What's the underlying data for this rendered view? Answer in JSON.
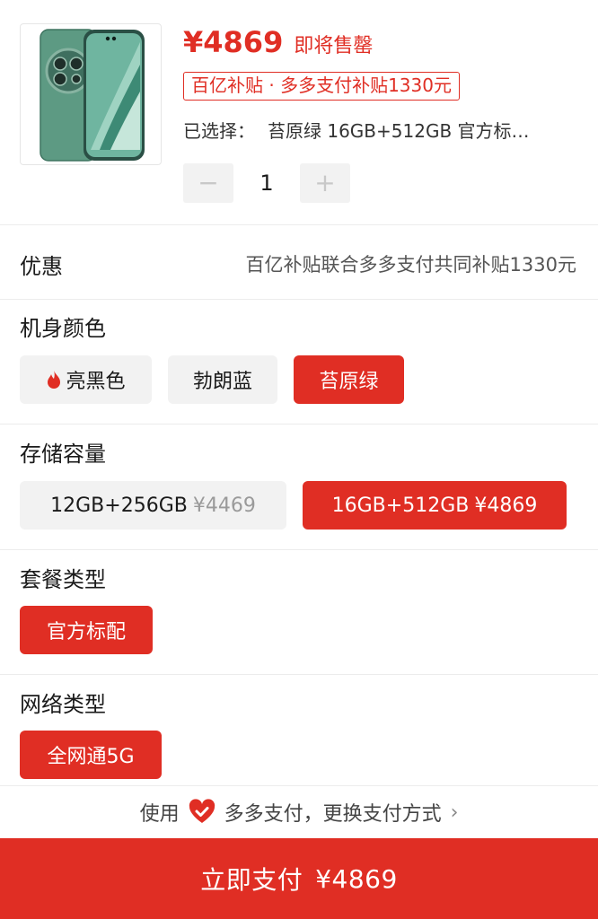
{
  "product": {
    "price": "¥4869",
    "status": "即将售罄",
    "subsidy_tag": "百亿补贴 · 多多支付补贴1330元",
    "selected_label": "已选择：",
    "selected_value": "苔原绿 16GB+512GB 官方标…",
    "quantity": "1",
    "minus": "−",
    "plus": "+",
    "image_icon": "phone-product-image"
  },
  "discount": {
    "title": "优惠",
    "value": "百亿补贴联合多多支付共同补贴1330元"
  },
  "color_section": {
    "title": "机身颜色",
    "options": [
      {
        "label": "亮黑色",
        "icon": "flame-icon",
        "selected": false
      },
      {
        "label": "勃朗蓝",
        "selected": false
      },
      {
        "label": "苔原绿",
        "selected": true
      }
    ]
  },
  "storage_section": {
    "title": "存储容量",
    "options": [
      {
        "label": "12GB+256GB",
        "price": "¥4469",
        "selected": false
      },
      {
        "label": "16GB+512GB",
        "price": "¥4869",
        "selected": true
      }
    ]
  },
  "package_section": {
    "title": "套餐类型",
    "options": [
      {
        "label": "官方标配",
        "selected": true
      }
    ]
  },
  "network_section": {
    "title": "网络类型",
    "options": [
      {
        "label": "全网通5G",
        "selected": true
      }
    ]
  },
  "payment": {
    "prefix": "使用",
    "method": "多多支付，更换支付方式",
    "icon": "heart-check-icon",
    "chevron": "›"
  },
  "pay_button": {
    "label": "立即支付",
    "amount": "¥4869"
  },
  "colors": {
    "accent": "#e02e24",
    "chip_bg": "#f2f2f2",
    "phone_green": "#4d8a72"
  }
}
